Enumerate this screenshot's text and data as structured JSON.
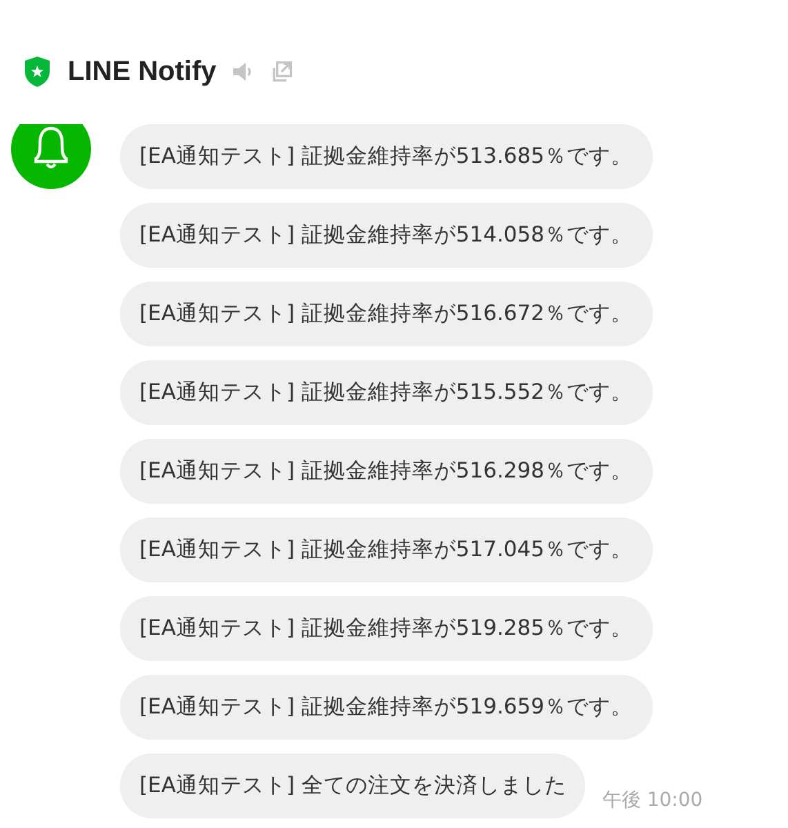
{
  "header": {
    "title": "LINE Notify"
  },
  "messages": [
    {
      "text": "[EA通知テスト] 証拠金維持率が513.685％です。"
    },
    {
      "text": "[EA通知テスト] 証拠金維持率が514.058％です。"
    },
    {
      "text": "[EA通知テスト] 証拠金維持率が516.672％です。"
    },
    {
      "text": "[EA通知テスト] 証拠金維持率が515.552％です。"
    },
    {
      "text": "[EA通知テスト] 証拠金維持率が516.298％です。"
    },
    {
      "text": "[EA通知テスト] 証拠金維持率が517.045％です。"
    },
    {
      "text": "[EA通知テスト] 証拠金維持率が519.285％です。"
    },
    {
      "text": "[EA通知テスト] 証拠金維持率が519.659％です。"
    },
    {
      "text": "[EA通知テスト] 全ての注文を決済しました",
      "time": "午後 10:00"
    }
  ]
}
